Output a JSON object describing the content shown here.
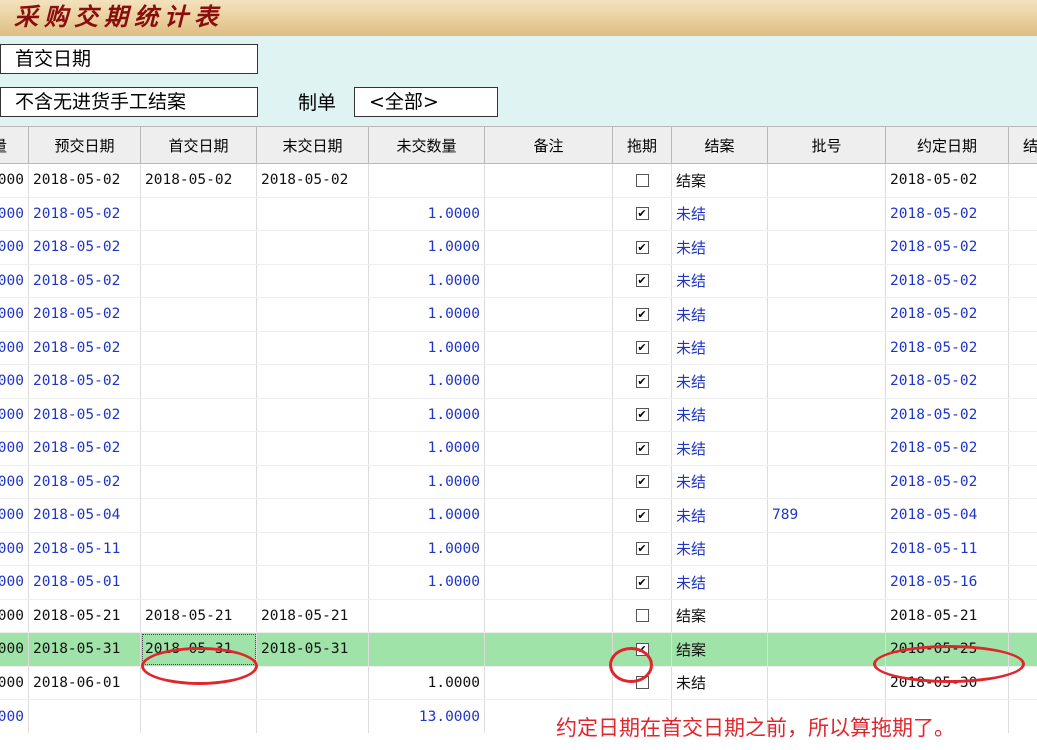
{
  "title": "采购交期统计表",
  "filters": {
    "date_type": "首交日期",
    "case_filter": "不含无进货手工结案",
    "maker_label": "制单",
    "maker_value": "<全部>"
  },
  "columns": [
    "量",
    "预交日期",
    "首交日期",
    "末交日期",
    "未交数量",
    "备注",
    "拖期",
    "结案",
    "批号",
    "约定日期",
    "结案"
  ],
  "rows": [
    {
      "qty": "000",
      "pre": "2018-05-02",
      "first": "2018-05-02",
      "last": "2018-05-02",
      "remain": "",
      "note": "",
      "delay": false,
      "status": "结案",
      "batch": "",
      "agreed": "2018-05-02",
      "kind": "closed"
    },
    {
      "qty": "000",
      "pre": "2018-05-02",
      "first": "",
      "last": "",
      "remain": "1.0000",
      "note": "",
      "delay": true,
      "status": "未结",
      "batch": "",
      "agreed": "2018-05-02",
      "kind": "open"
    },
    {
      "qty": "000",
      "pre": "2018-05-02",
      "first": "",
      "last": "",
      "remain": "1.0000",
      "note": "",
      "delay": true,
      "status": "未结",
      "batch": "",
      "agreed": "2018-05-02",
      "kind": "open"
    },
    {
      "qty": "000",
      "pre": "2018-05-02",
      "first": "",
      "last": "",
      "remain": "1.0000",
      "note": "",
      "delay": true,
      "status": "未结",
      "batch": "",
      "agreed": "2018-05-02",
      "kind": "open"
    },
    {
      "qty": "000",
      "pre": "2018-05-02",
      "first": "",
      "last": "",
      "remain": "1.0000",
      "note": "",
      "delay": true,
      "status": "未结",
      "batch": "",
      "agreed": "2018-05-02",
      "kind": "open"
    },
    {
      "qty": "000",
      "pre": "2018-05-02",
      "first": "",
      "last": "",
      "remain": "1.0000",
      "note": "",
      "delay": true,
      "status": "未结",
      "batch": "",
      "agreed": "2018-05-02",
      "kind": "open"
    },
    {
      "qty": "000",
      "pre": "2018-05-02",
      "first": "",
      "last": "",
      "remain": "1.0000",
      "note": "",
      "delay": true,
      "status": "未结",
      "batch": "",
      "agreed": "2018-05-02",
      "kind": "open"
    },
    {
      "qty": "000",
      "pre": "2018-05-02",
      "first": "",
      "last": "",
      "remain": "1.0000",
      "note": "",
      "delay": true,
      "status": "未结",
      "batch": "",
      "agreed": "2018-05-02",
      "kind": "open"
    },
    {
      "qty": "000",
      "pre": "2018-05-02",
      "first": "",
      "last": "",
      "remain": "1.0000",
      "note": "",
      "delay": true,
      "status": "未结",
      "batch": "",
      "agreed": "2018-05-02",
      "kind": "open"
    },
    {
      "qty": "000",
      "pre": "2018-05-02",
      "first": "",
      "last": "",
      "remain": "1.0000",
      "note": "",
      "delay": true,
      "status": "未结",
      "batch": "",
      "agreed": "2018-05-02",
      "kind": "open"
    },
    {
      "qty": "000",
      "pre": "2018-05-04",
      "first": "",
      "last": "",
      "remain": "1.0000",
      "note": "",
      "delay": true,
      "status": "未结",
      "batch": "789",
      "agreed": "2018-05-04",
      "kind": "open"
    },
    {
      "qty": "000",
      "pre": "2018-05-11",
      "first": "",
      "last": "",
      "remain": "1.0000",
      "note": "",
      "delay": true,
      "status": "未结",
      "batch": "",
      "agreed": "2018-05-11",
      "kind": "open"
    },
    {
      "qty": "000",
      "pre": "2018-05-01",
      "first": "",
      "last": "",
      "remain": "1.0000",
      "note": "",
      "delay": true,
      "status": "未结",
      "batch": "",
      "agreed": "2018-05-16",
      "kind": "open"
    },
    {
      "qty": "000",
      "pre": "2018-05-21",
      "first": "2018-05-21",
      "last": "2018-05-21",
      "remain": "",
      "note": "",
      "delay": false,
      "status": "结案",
      "batch": "",
      "agreed": "2018-05-21",
      "kind": "closed"
    },
    {
      "qty": "000",
      "pre": "2018-05-31",
      "first": "2018-05-31",
      "last": "2018-05-31",
      "remain": "",
      "note": "",
      "delay": true,
      "status": "结案",
      "batch": "",
      "agreed": "2018-05-25",
      "kind": "sel"
    },
    {
      "qty": "000",
      "pre": "2018-06-01",
      "first": "",
      "last": "",
      "remain": "1.0000",
      "note": "",
      "delay": false,
      "status": "未结",
      "batch": "",
      "agreed": "2018-05-30",
      "kind": "closed"
    }
  ],
  "summary": {
    "qty": "000",
    "remain": "13.0000"
  },
  "annotation": "约定日期在首交日期之前，所以算拖期了。",
  "colors": {
    "accent_red": "#e0262d",
    "open_text": "#1f35c6",
    "selected_row": "#9fe3a8",
    "filter_bg": "#dff3f3"
  }
}
